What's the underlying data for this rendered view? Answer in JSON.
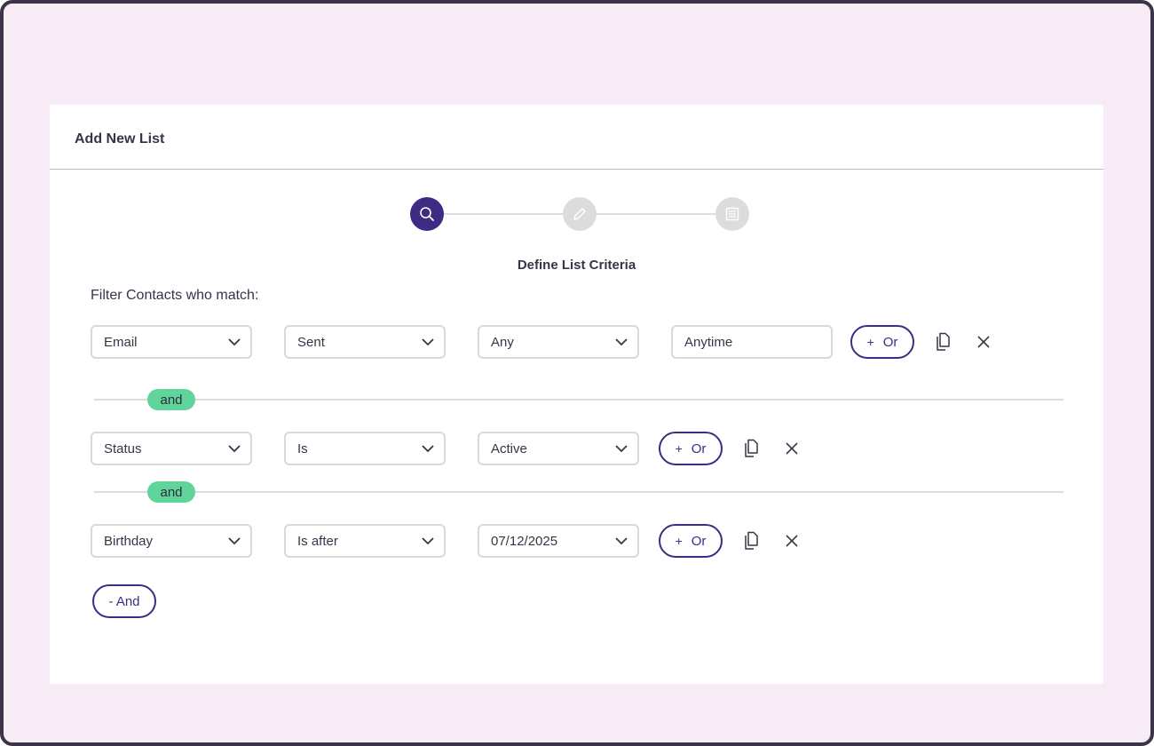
{
  "card": {
    "title": "Add New List"
  },
  "steps": [
    {
      "icon": "search-icon",
      "active": true
    },
    {
      "icon": "pencil-icon",
      "active": false
    },
    {
      "icon": "list-icon",
      "active": false
    }
  ],
  "section_title": "Define List Criteria",
  "filter_label": "Filter Contacts who match:",
  "rows": [
    {
      "field": "Email",
      "operator": "Sent",
      "value": "Any",
      "extra_value": "Anytime",
      "or_label": "Or"
    },
    {
      "field": "Status",
      "operator": "Is",
      "value": "Active",
      "or_label": "Or"
    },
    {
      "field": "Birthday",
      "operator": "Is after",
      "value": "07/12/2025",
      "or_label": "Or"
    }
  ],
  "joiners": [
    "and",
    "and"
  ],
  "or_plus": "+",
  "and_button_label": "- And",
  "colors": {
    "accent": "#3f2a84",
    "and_pill": "#5fd59b",
    "background": "#f7ecf5"
  }
}
